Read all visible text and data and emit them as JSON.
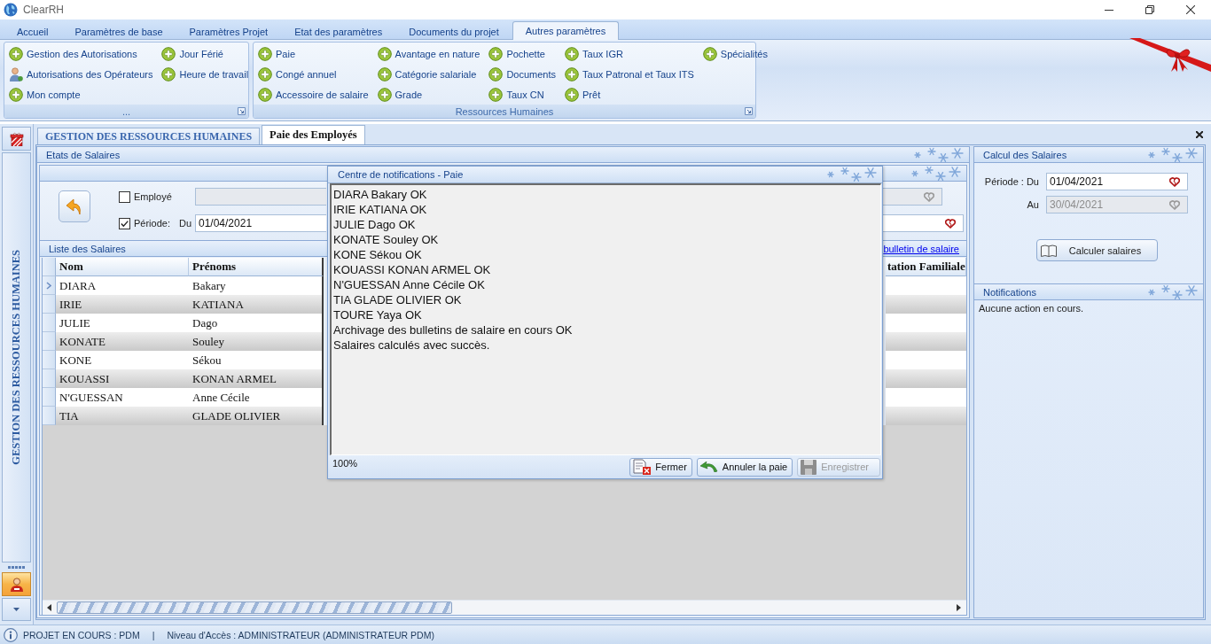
{
  "window": {
    "title": "ClearRH"
  },
  "ribbon_tabs": [
    {
      "label": "Accueil",
      "selected": false
    },
    {
      "label": "Paramètres de base",
      "selected": false
    },
    {
      "label": "Paramètres Projet",
      "selected": false
    },
    {
      "label": "Etat des paramètres",
      "selected": false
    },
    {
      "label": "Documents du projet",
      "selected": false
    },
    {
      "label": "Autres paramètres",
      "selected": true
    }
  ],
  "ribbon_groups": [
    {
      "caption": "...",
      "columns": [
        [
          {
            "label": "Gestion des Autorisations",
            "kind": "plus"
          },
          {
            "label": "Autorisations des Opérateurs",
            "kind": "user"
          },
          {
            "label": "Mon compte",
            "kind": "plus"
          }
        ],
        [
          {
            "label": "Jour Férié",
            "kind": "plus"
          },
          {
            "label": "Heure de travail",
            "kind": "plus"
          }
        ]
      ]
    },
    {
      "caption": "Ressources Humaines",
      "columns": [
        [
          {
            "label": "Paie",
            "kind": "plus"
          },
          {
            "label": "Congé annuel",
            "kind": "plus"
          },
          {
            "label": "Accessoire de salaire",
            "kind": "plus"
          }
        ],
        [
          {
            "label": "Avantage en nature",
            "kind": "plus"
          },
          {
            "label": "Catégorie salariale",
            "kind": "plus"
          },
          {
            "label": "Grade",
            "kind": "plus"
          }
        ],
        [
          {
            "label": "Pochette",
            "kind": "plus"
          },
          {
            "label": "Documents",
            "kind": "plus"
          },
          {
            "label": "Taux CN",
            "kind": "plus"
          }
        ],
        [
          {
            "label": "Taux IGR",
            "kind": "plus"
          },
          {
            "label": "Taux Patronal et Taux ITS",
            "kind": "plus"
          },
          {
            "label": "Prêt",
            "kind": "plus"
          }
        ],
        [
          {
            "label": "Spécialités",
            "kind": "plus"
          }
        ]
      ]
    }
  ],
  "sidebar": {
    "title": "GESTION DES RESSOURCES HUMAINES"
  },
  "document_tabs": [
    {
      "label": "GESTION DES RESSOURCES HUMAINES",
      "selected": false
    },
    {
      "label": "Paie des Employés",
      "selected": true
    }
  ],
  "etats_salaires": {
    "title": "Etats de Salaires",
    "employee_filter": {
      "label": "Employé",
      "checked": false
    },
    "employee_field": {
      "disabled": true
    },
    "period_filter": {
      "label": "Période:",
      "checked": true
    },
    "from_label": "Du",
    "from_field": {
      "value": "01/04/2021",
      "disabled": false
    }
  },
  "liste_salaires": {
    "title": "Liste des Salaires",
    "link": "bulletin de salaire",
    "columns": [
      "Nom",
      "Prénoms",
      "tation Familiale"
    ],
    "rows": [
      {
        "nom": "DIARA",
        "prenoms": "Bakary",
        "current": true
      },
      {
        "nom": "IRIE",
        "prenoms": "KATIANA",
        "current": false
      },
      {
        "nom": "JULIE",
        "prenoms": "Dago",
        "current": false
      },
      {
        "nom": "KONATE",
        "prenoms": "Souley",
        "current": false
      },
      {
        "nom": "KONE",
        "prenoms": "Sékou",
        "current": false
      },
      {
        "nom": "KOUASSI",
        "prenoms": "KONAN ARMEL",
        "current": false
      },
      {
        "nom": "N'GUESSAN",
        "prenoms": "Anne Cécile",
        "current": false
      },
      {
        "nom": "TIA",
        "prenoms": "GLADE OLIVIER",
        "current": false
      }
    ]
  },
  "dialog": {
    "title": "Centre de notifications - Paie",
    "lines": [
      "DIARA Bakary OK",
      "IRIE KATIANA OK",
      "JULIE Dago OK",
      "KONATE Souley OK",
      "KONE Sékou OK",
      "KOUASSI KONAN ARMEL OK",
      "N'GUESSAN Anne Cécile OK",
      "TIA GLADE OLIVIER OK",
      "TOURE Yaya OK",
      "Archivage des bulletins de salaire en cours OK",
      "Salaires calculés avec succès."
    ],
    "zoom": "100%",
    "buttons": [
      {
        "label": "Fermer",
        "kind": "close",
        "disabled": false
      },
      {
        "label": "Annuler la paie",
        "kind": "undo",
        "disabled": false
      },
      {
        "label": "Enregistrer",
        "kind": "save",
        "disabled": true
      }
    ]
  },
  "calcul_salaires": {
    "title": "Calcul des Salaires",
    "from_label": "Période : Du",
    "from_field": {
      "value": "01/04/2021",
      "disabled": false
    },
    "to_label": "Au",
    "to_field": {
      "value": "30/04/2021",
      "disabled": true
    },
    "button": "Calculer salaires"
  },
  "notifications": {
    "title": "Notifications",
    "message": "Aucune action en cours."
  },
  "status_bar": {
    "project": "PROJET EN COURS : PDM",
    "separator": "|",
    "access": "Niveau d'Accès : ADMINISTRATEUR (ADMINISTRATEUR PDM)"
  }
}
